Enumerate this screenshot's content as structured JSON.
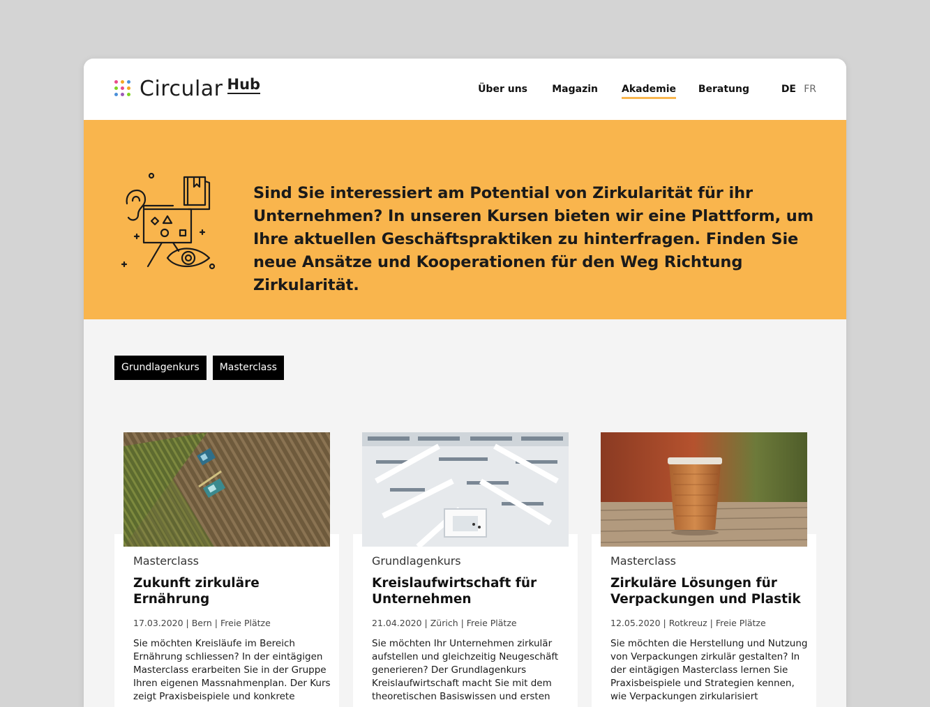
{
  "header": {
    "logo": {
      "word": "Circular",
      "hub": "Hub"
    },
    "nav": [
      {
        "label": "Über uns",
        "active": false
      },
      {
        "label": "Magazin",
        "active": false
      },
      {
        "label": "Akademie",
        "active": true
      },
      {
        "label": "Beratung",
        "active": false
      }
    ],
    "languages": [
      {
        "label": "DE",
        "selected": true
      },
      {
        "label": "FR",
        "selected": false
      }
    ]
  },
  "banner": {
    "icon": "learning-illustration-icon",
    "text": "Sind Sie interessiert am Potential von Zirkularität für ihr Unternehmen? In unseren Kursen bieten wir eine Plattform, um Ihre aktuellen Geschäftspraktiken zu hinterfragen. Finden Sie neue Ansätze und Kooperationen für den Weg Richtung Zirkularität."
  },
  "filters": [
    {
      "label": "Grundlagenkurs"
    },
    {
      "label": "Masterclass"
    }
  ],
  "cards": [
    {
      "image": "field-harvest-photo",
      "category": "Masterclass",
      "title": "Zukunft zirkuläre Ernährung",
      "meta": "17.03.2020 | Bern | Freie Plätze",
      "description": "Sie möchten Kreisläufe im Bereich Ernährung schliessen? In der eintägigen Masterclass erarbeiten Sie in der Gruppe Ihren eigenen Massnahmenplan. Der Kurs zeigt Praxisbeispiele und konkrete"
    },
    {
      "image": "library-atrium-photo",
      "category": "Grundlagenkurs",
      "title": "Kreislaufwirtschaft für Unternehmen",
      "meta": "21.04.2020 | Zürich | Freie Plätze",
      "description": "Sie möchten Ihr Unternehmen zirkulär aufstellen und gleichzeitig Neugeschäft generieren? Der Grundlagenkurs Kreislaufwirtschaft macht Sie mit dem theoretischen Basiswissen und ersten"
    },
    {
      "image": "paper-coffee-cup-photo",
      "category": "Masterclass",
      "title": "Zirkuläre Lösungen für Verpackungen und Plastik",
      "meta": "12.05.2020 | Rotkreuz | Freie Plätze",
      "description": "Sie möchten die Herstellung und Nutzung von Verpackungen zirkulär gestalten? In der eintägigen Masterclass lernen Sie Praxisbeispiele und Strategien kennen, wie Verpackungen zirkularisiert"
    }
  ],
  "colors": {
    "accent": "#f9b54d",
    "background": "#f4f4f4",
    "filter": "#000000"
  }
}
